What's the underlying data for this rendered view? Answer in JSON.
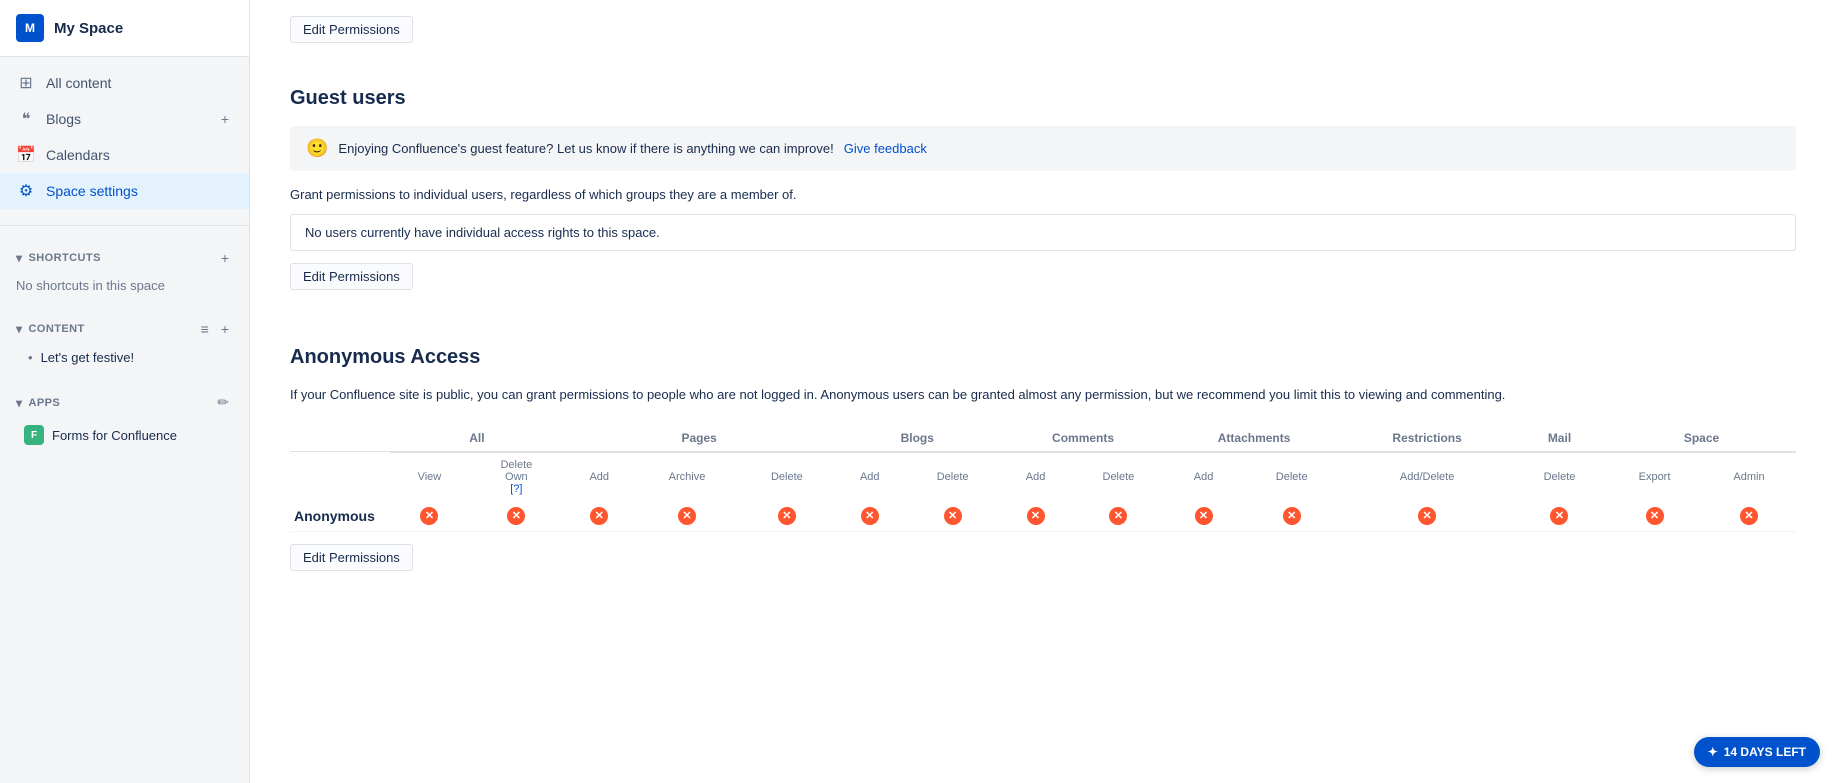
{
  "sidebar": {
    "logo_text": "M",
    "title": "My Space",
    "nav": [
      {
        "id": "all-content",
        "label": "All content",
        "icon": "⊞"
      },
      {
        "id": "blogs",
        "label": "Blogs",
        "icon": "❝",
        "action": "+"
      },
      {
        "id": "calendars",
        "label": "Calendars",
        "icon": "📅"
      },
      {
        "id": "space-settings",
        "label": "Space settings",
        "icon": "⚙",
        "active": true
      }
    ],
    "shortcuts": {
      "heading": "SHORTCUTS",
      "empty_text": "No shortcuts in this space"
    },
    "content": {
      "heading": "CONTENT",
      "items": [
        "Let's get festive!"
      ]
    },
    "apps": {
      "heading": "APPS",
      "items": [
        {
          "id": "forms-for-confluence",
          "label": "Forms for Confluence",
          "icon": "F"
        }
      ]
    }
  },
  "main": {
    "top_edit_btn": "Edit Permissions",
    "guest_users": {
      "title": "Guest users",
      "banner_text": "Enjoying Confluence's guest feature? Let us know if there is anything we can improve!",
      "banner_link": "Give feedback",
      "grant_text": "Grant permissions to individual users, regardless of which groups they are a member of.",
      "no_access_text": "No users currently have individual access rights to this space.",
      "edit_btn": "Edit Permissions"
    },
    "anonymous_access": {
      "title": "Anonymous Access",
      "description": "If your Confluence site is public, you can grant permissions to people who are not logged in. Anonymous users can be granted almost any permission, but we recommend you limit this to viewing and commenting.",
      "table": {
        "group_headers": [
          "All",
          "Pages",
          "Blogs",
          "Comments",
          "Attachments",
          "Restrictions",
          "Mail",
          "Space"
        ],
        "sub_headers": {
          "All": [
            "View",
            "Delete Own [?]"
          ],
          "Pages": [
            "Add",
            "Archive",
            "Delete"
          ],
          "Blogs": [
            "Add",
            "Delete"
          ],
          "Comments": [
            "Add",
            "Delete"
          ],
          "Attachments": [
            "Add",
            "Delete"
          ],
          "Restrictions": [
            "Add/Delete"
          ],
          "Mail": [
            "Delete"
          ],
          "Space": [
            "Export",
            "Admin"
          ]
        },
        "row_label": "Anonymous",
        "all_denied": true
      },
      "edit_btn": "Edit Permissions"
    }
  },
  "trial": {
    "label": "14 DAYS LEFT",
    "icon": "✦"
  }
}
